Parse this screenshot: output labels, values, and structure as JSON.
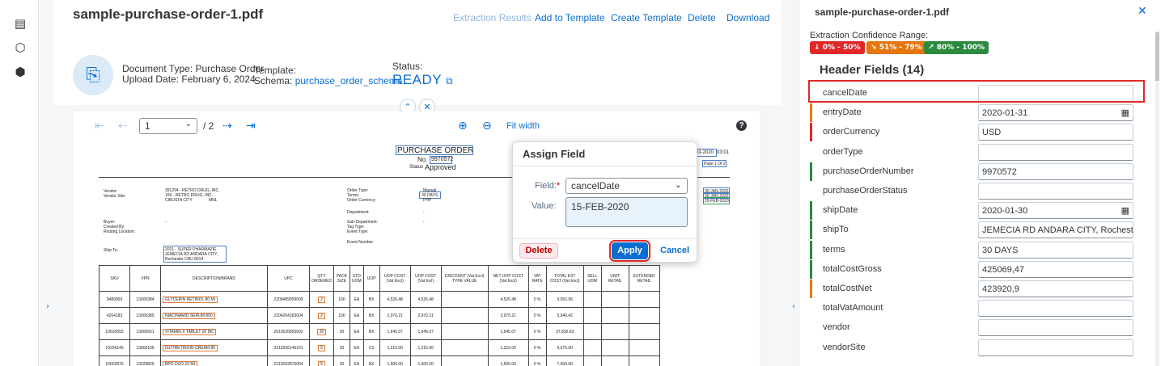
{
  "document": {
    "title": "sample-purchase-order-1.pdf",
    "actions": [
      "Extraction Results",
      "Add to Template",
      "Create Template",
      "Delete",
      "Download"
    ],
    "document_type_label": "Document Type: Purchase Order",
    "upload_date_label": "Upload Date: February 6, 2024",
    "template_label": "Template:",
    "schema_label": "Schema:",
    "schema_value": "purchase_order_schema",
    "status_label": "Status:",
    "status_value": "READY"
  },
  "viewer": {
    "page_current": "1",
    "page_total": "/ 2",
    "fit_width": "Fit width",
    "help": "?"
  },
  "paper": {
    "title": "PURCHASE ORDER",
    "no_label": "No.",
    "no_value": "9970572",
    "status_label": "Status",
    "status_value": "Approved",
    "date_top": "01-2020",
    "date_top_time": "03:01",
    "page_label": "Page 1 Of 2",
    "vendor_label": "Vendor:",
    "vendor_site_label": "Vendor Site:",
    "vendor_value": "391294 - RETRO DRUG, INC.",
    "vendor_site_value": "169 - RETRO DRUG, INC.",
    "vendor_city": "CIBUSTA CITY",
    "vendor_city2": "MNL",
    "order_type_label": "Order Type:",
    "terms_label": "Terms:",
    "currency_label": "Order Currency:",
    "order_type_value": "Manual",
    "terms_value": "30 DAYS",
    "currency_value": "PHP",
    "department_label": "Department:",
    "buyer_label": "Buyer:",
    "created_label": "Created By:",
    "routing_label": "Routing Location:",
    "subdept_label": "Sub-Department:",
    "tagtype_label": "Tag Type:",
    "eventtype_label": "Event Type:",
    "eventnum_label": "Event Number:",
    "dash": "-",
    "dates": [
      "30-JAN-2020",
      "30-JAN-2020",
      "15-FEB-2020"
    ],
    "shipto_label": "Ship To:",
    "shipto_lines": [
      "2021 - SUPER PHARMAZIE",
      "JEMECIA RD ANDARA CITY,",
      "Rochester   CBU   8014"
    ],
    "headers": [
      "SKU",
      "VPN",
      "DESCRIPTION/BRAND",
      "UPC",
      "QTY ORDERED",
      "PACK SIZE",
      "STD UOM",
      "UOP",
      "UOP COST (Vat Excl)",
      "UOP COST (Vat Incl)",
      "DISCOUNT (Vat Excl) TYPE VALUE",
      "NET UOP COST (Vat Excl)",
      "VAT RATE",
      "TOTAL EXT COST (Vat Excl)",
      "SELL UOM",
      "UNIT RETAIL",
      "EXTENDED RETAIL"
    ],
    "rows": [
      [
        "9489959",
        "13000384",
        "GLYCERIN RETINOL 80 MI",
        "2209489959009",
        "2",
        "100",
        "EA",
        "BX",
        "4,526.48",
        "4,526.48",
        "",
        "4,526.48",
        "0 %",
        "9,052.96",
        "",
        "",
        ""
      ],
      [
        "4204183",
        "13000385",
        "NIACINAMID SERUM 800",
        "2204204183004",
        "2",
        "100",
        "EA",
        "BX",
        "2,970.21",
        "2,970.21",
        "",
        "2,970.21",
        "0 %",
        "5,940.42",
        "",
        "",
        ""
      ],
      [
        "10520655",
        "13000551",
        "VITAMIN X TABLET 20 MC",
        "2010520655002",
        "20",
        "30",
        "EA",
        "BX",
        "1,645.07",
        "1,645.07",
        "",
        "1,645.07",
        "0 %",
        "37,836.63",
        "",
        "",
        ""
      ],
      [
        "10256146",
        "13000196",
        "ISOTRETINOIN CREAM 80",
        "3210256146101",
        "5",
        "30",
        "EA",
        "CS",
        "1,215.00",
        "1,215.00",
        "",
        "1,215.00",
        "0 %",
        "6,075.00",
        "",
        "",
        ""
      ],
      [
        "10002876",
        "13029826",
        "BPO DUO 10 MI",
        "2210002876004",
        "5",
        "30",
        "EA",
        "BX",
        "1,500.00",
        "1,500.00",
        "",
        "1,500.00",
        "0 %",
        "7,500.00",
        "",
        "",
        ""
      ]
    ]
  },
  "dialog": {
    "title": "Assign Field",
    "field_label": "Field:",
    "required_mark": "*",
    "field_value": "cancelDate",
    "value_label": "Value:",
    "value_value": "15-FEB-2020",
    "delete": "Delete",
    "apply": "Apply",
    "cancel": "Cancel"
  },
  "panel": {
    "title": "sample-purchase-order-1.pdf",
    "range_label": "Extraction Confidence Range:",
    "badges": [
      {
        "label": "0% - 50%",
        "color": "#e02828",
        "icon": "down-arrow-icon"
      },
      {
        "label": "51% - 79%",
        "color": "#e6760f",
        "icon": "trend-down-icon"
      },
      {
        "label": "80% - 100%",
        "color": "#2b8a3e",
        "icon": "trend-up-icon"
      }
    ],
    "header_fields_title": "Header Fields (14)",
    "fields": [
      {
        "name": "cancelDate",
        "value": "",
        "bar": "",
        "calendar": false
      },
      {
        "name": "entryDate",
        "value": "2020-01-31",
        "bar": "#e6760f",
        "calendar": true
      },
      {
        "name": "orderCurrency",
        "value": "USD",
        "bar": "#e02828",
        "calendar": false
      },
      {
        "name": "orderType",
        "value": "",
        "bar": "",
        "calendar": false
      },
      {
        "name": "purchaseOrderNumber",
        "value": "9970572",
        "bar": "#2b8a3e",
        "calendar": false
      },
      {
        "name": "purchaseOrderStatus",
        "value": "",
        "bar": "",
        "calendar": false
      },
      {
        "name": "shipDate",
        "value": "2020-01-30",
        "bar": "#2b8a3e",
        "calendar": true
      },
      {
        "name": "shipTo",
        "value": "JEMECIA RD ANDARA CITY, Rochester...",
        "bar": "#2b8a3e",
        "calendar": false
      },
      {
        "name": "terms",
        "value": "30 DAYS",
        "bar": "#2b8a3e",
        "calendar": false
      },
      {
        "name": "totalCostGross",
        "value": "425069,47",
        "bar": "#2b8a3e",
        "calendar": false
      },
      {
        "name": "totalCostNet",
        "value": "423920,9",
        "bar": "#e6760f",
        "calendar": false
      },
      {
        "name": "totalVatAmount",
        "value": "",
        "bar": "",
        "calendar": false
      },
      {
        "name": "vendor",
        "value": "",
        "bar": "",
        "calendar": false
      },
      {
        "name": "vendorSite",
        "value": "",
        "bar": "",
        "calendar": false
      }
    ]
  }
}
